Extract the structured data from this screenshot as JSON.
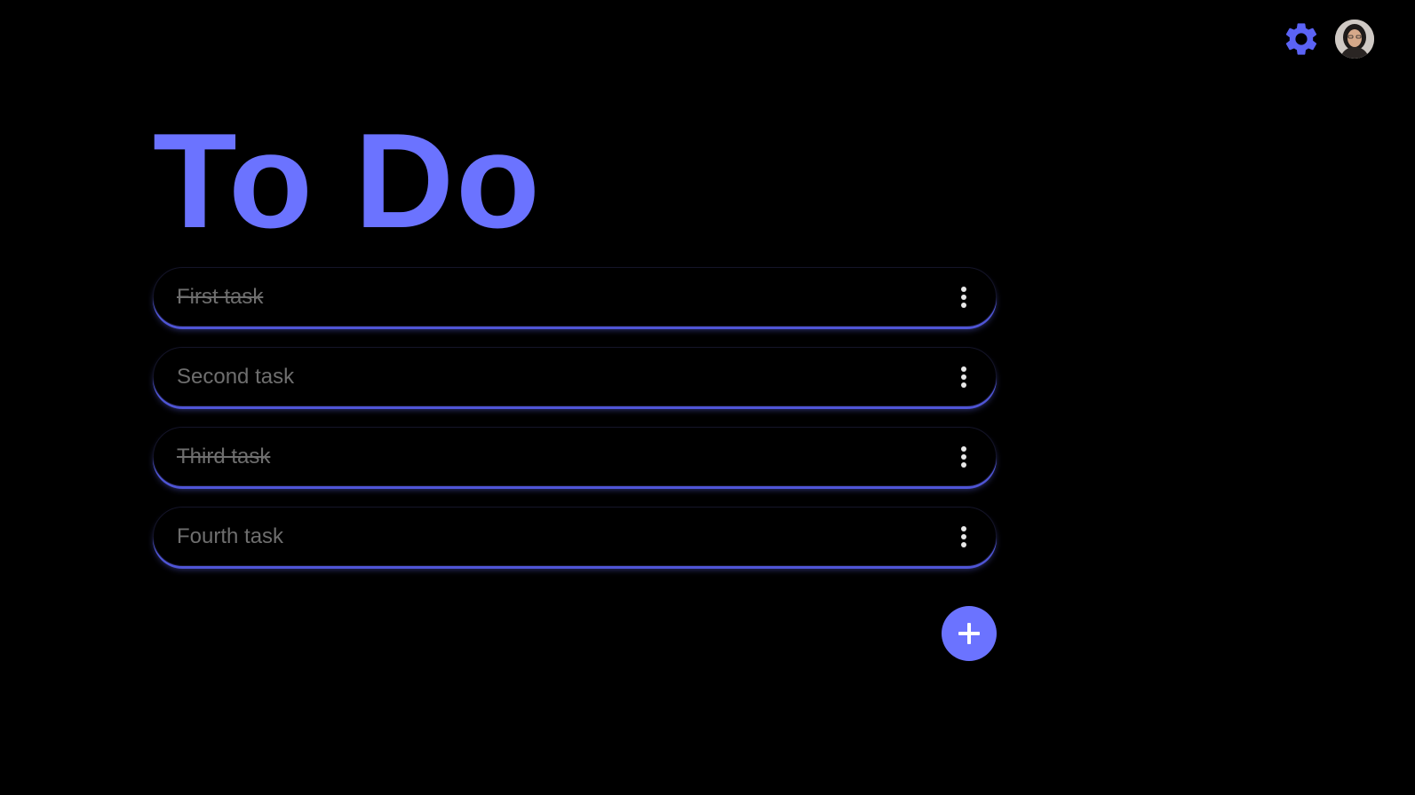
{
  "header": {
    "title": "To Do",
    "settings_icon": "gear-icon",
    "avatar_icon": "user-avatar"
  },
  "tasks": [
    {
      "label": "First task",
      "done": true
    },
    {
      "label": "Second task",
      "done": false
    },
    {
      "label": "Third task",
      "done": true
    },
    {
      "label": "Fourth task",
      "done": false
    }
  ],
  "actions": {
    "add_icon": "plus-icon",
    "task_menu_icon": "more-vertical-icon"
  },
  "colors": {
    "accent": "#6b73ff",
    "background": "#000000",
    "task_text": "#6e6e6e"
  }
}
